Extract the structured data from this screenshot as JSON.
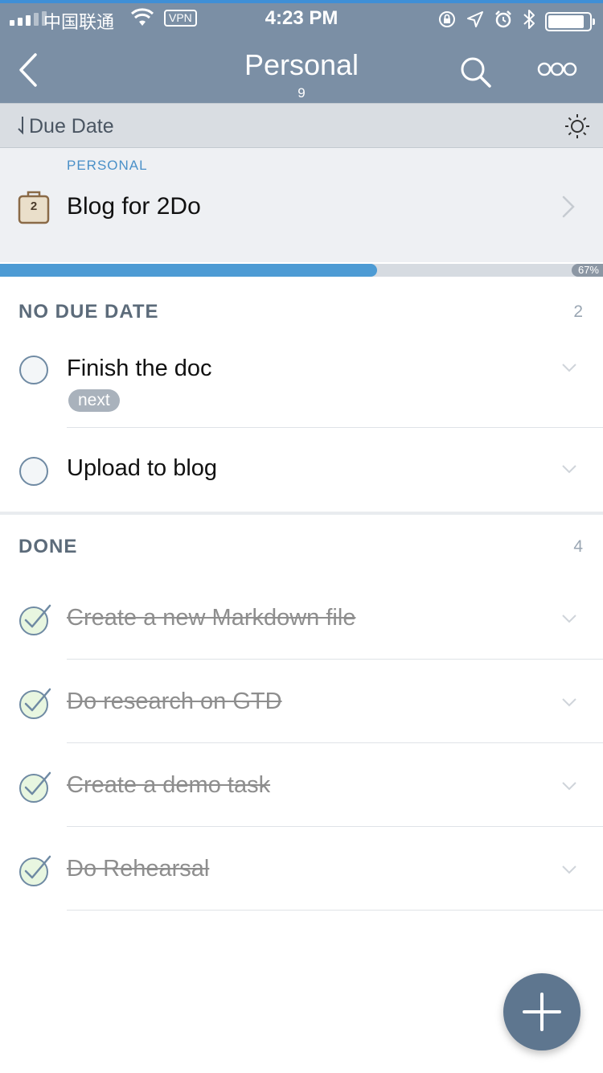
{
  "status_bar": {
    "carrier": "中国联通",
    "vpn": "VPN",
    "time": "4:23 PM"
  },
  "nav": {
    "title": "Personal",
    "count": "9"
  },
  "sort": {
    "label": "Due Date"
  },
  "project": {
    "kicker": "PERSONAL",
    "title": "Blog for 2Do",
    "badge": "2",
    "progress_percent": 67,
    "progress_label": "67%"
  },
  "sections": {
    "no_due": {
      "name": "NO DUE DATE",
      "count": "2",
      "tasks": [
        {
          "title": "Finish the doc",
          "tag": "next"
        },
        {
          "title": "Upload to blog"
        }
      ]
    },
    "done": {
      "name": "DONE",
      "count": "4",
      "tasks": [
        {
          "title": "Create a new Markdown file"
        },
        {
          "title": "Do research on GTD"
        },
        {
          "title": "Create a demo task"
        },
        {
          "title": "Do Rehearsal"
        }
      ]
    }
  },
  "colors": {
    "header": "#7b8fa5",
    "accent_blue": "#4d9bd4",
    "fab": "#5e768f",
    "done_check_fill": "#e8f6e0"
  },
  "icons": {
    "back": "chevron-left-icon",
    "search": "search-icon",
    "more": "more-dots-icon",
    "sun": "sun-icon",
    "add": "plus-icon"
  }
}
